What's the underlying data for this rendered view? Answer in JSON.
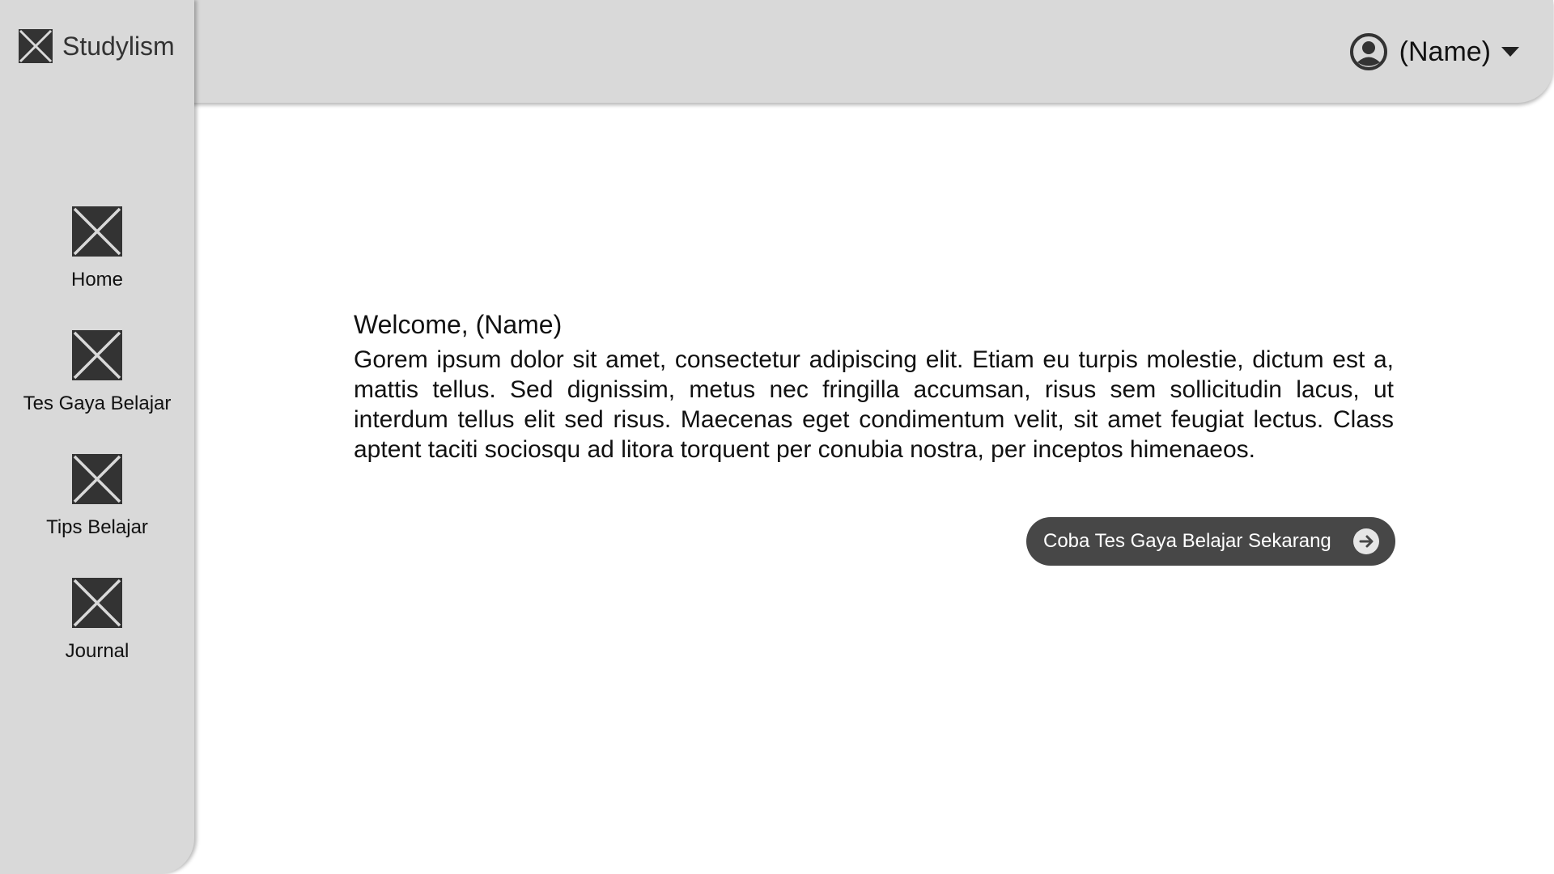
{
  "app": {
    "brand_name": "Studylism",
    "brand_icon": "image-placeholder-icon"
  },
  "header": {
    "user_name": "(Name)",
    "user_icon": "user-circle-icon",
    "dropdown_icon": "caret-down-icon"
  },
  "sidebar": {
    "items": [
      {
        "label": "Home",
        "icon": "image-placeholder-icon"
      },
      {
        "label": "Tes Gaya Belajar",
        "icon": "image-placeholder-icon"
      },
      {
        "label": "Tips Belajar",
        "icon": "image-placeholder-icon"
      },
      {
        "label": "Journal",
        "icon": "image-placeholder-icon"
      }
    ]
  },
  "main": {
    "welcome": "Welcome, (Name)",
    "description": "Gorem ipsum dolor sit amet, consectetur adipiscing elit. Etiam eu turpis molestie, dictum est a, mattis tellus. Sed dignissim, metus nec fringilla accumsan, risus sem sollicitudin lacus, ut interdum tellus elit sed risus. Maecenas eget condimentum velit, sit amet feugiat lectus. Class aptent taciti sociosqu ad litora torquent per conubia nostra, per inceptos himenaeos.",
    "cta_label": "Coba Tes Gaya Belajar Sekarang",
    "cta_icon": "arrow-right-circle-icon"
  },
  "colors": {
    "panel_gray": "#d9d9d9",
    "button_dark": "#474747",
    "icon_dark": "#333333",
    "background": "#ffffff"
  }
}
